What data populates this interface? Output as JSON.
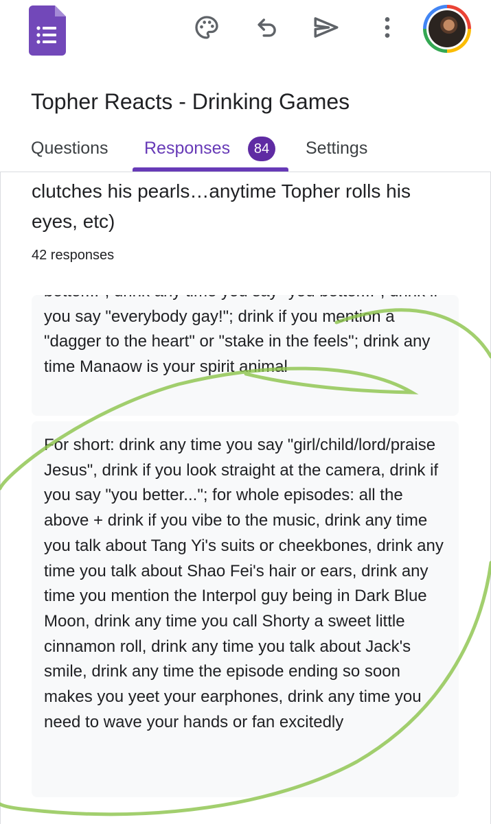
{
  "toolbar": {
    "app_icon": "google-forms-icon",
    "icons": [
      "palette-icon",
      "undo-icon",
      "send-icon",
      "more-vert-icon"
    ],
    "avatar": "user-avatar"
  },
  "form": {
    "title": "Topher Reacts - Drinking Games"
  },
  "tabs": [
    {
      "label": "Questions"
    },
    {
      "label": "Responses",
      "badge": "84",
      "active": true
    },
    {
      "label": "Settings"
    }
  ],
  "question": {
    "text": "clutches his pearls…anytime Topher rolls his eyes, etc)",
    "responses_count": "42 responses"
  },
  "responses": [
    {
      "text": "better...\"; drink any time you say \"you better...\"; drink if you say \"everybody gay!\"; drink if you mention a \"dagger to the heart\" or \"stake in the feels\"; drink any time Manaow is your spirit animal"
    },
    {
      "text": "For short: drink any time you say \"girl/child/lord/praise Jesus\", drink if you look straight at the camera, drink if you say \"you better...\"; for whole episodes: all the above + drink if you vibe to the music, drink any time you talk about Tang Yi's suits or cheekbones, drink any time you talk about Shao Fei's hair or ears, drink any time you mention the Interpol guy being in Dark Blue Moon, drink any time you call Shorty a sweet little cinnamon roll, drink any time you talk about Jack's smile, drink any time the episode ending so soon makes you yeet your earphones, drink any time you need to wave your hands or fan excitedly"
    }
  ],
  "colors": {
    "accent": "#673ab7",
    "badge": "#5f2ba3",
    "card_bg": "#f8f9fa",
    "annotation": "#8bc34a"
  }
}
